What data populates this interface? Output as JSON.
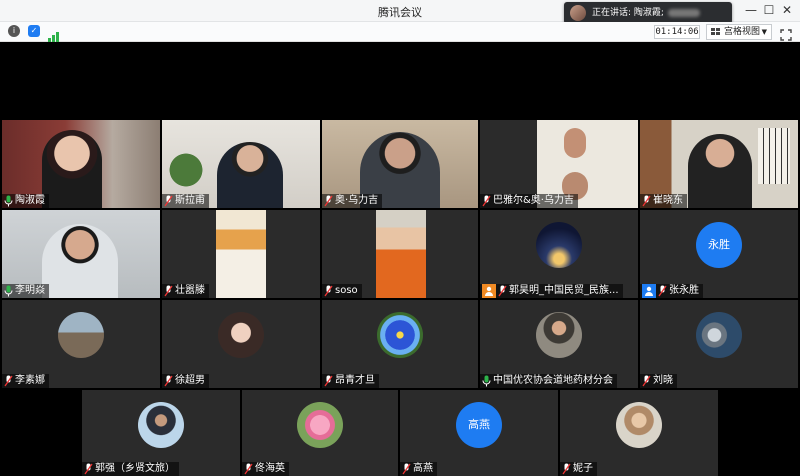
{
  "window": {
    "title": "腾讯会议",
    "speaking_label": "正在讲话: 陶淑霞;",
    "controls": [
      "—",
      "☐",
      "✕"
    ]
  },
  "toolbar": {
    "timer": "01:14:06",
    "view_label": "宫格视图",
    "icons": [
      "info-icon",
      "shield-icon",
      "signal-icon"
    ]
  },
  "colors": {
    "accent": "#1e7cf2",
    "stage": "#000000",
    "tile": "#2b2b2b",
    "orange": "#f08a24"
  },
  "participants": [
    {
      "name": "陶淑霞",
      "mic": "on"
    },
    {
      "name": "斯拉甫",
      "mic": "off"
    },
    {
      "name": "奥·乌力吉",
      "mic": "off"
    },
    {
      "name": "巴雅尔&奥·乌力吉",
      "mic": "off"
    },
    {
      "name": "崔晓东",
      "mic": "off"
    },
    {
      "name": "李明焱",
      "mic": "on"
    },
    {
      "name": "壮嚣滕",
      "mic": "off"
    },
    {
      "name": "soso",
      "mic": "off"
    },
    {
      "name": "郭昊明_中国民贸_民族...",
      "mic": "off",
      "badge": "phone"
    },
    {
      "name": "张永胜",
      "mic": "off",
      "badge": "user",
      "avatar_text": "永胜"
    },
    {
      "name": "李素娜",
      "mic": "off"
    },
    {
      "name": "徐超男",
      "mic": "off"
    },
    {
      "name": "昂青才旦",
      "mic": "off"
    },
    {
      "name": "中国优农协会道地药材分会",
      "mic": "on"
    },
    {
      "name": "刘晓",
      "mic": "off"
    },
    {
      "name": "郭强（乡贤文旅）",
      "mic": "off"
    },
    {
      "name": "佟海英",
      "mic": "off"
    },
    {
      "name": "高燕",
      "mic": "off",
      "avatar_text": "高燕"
    },
    {
      "name": "妮子",
      "mic": "off"
    }
  ]
}
